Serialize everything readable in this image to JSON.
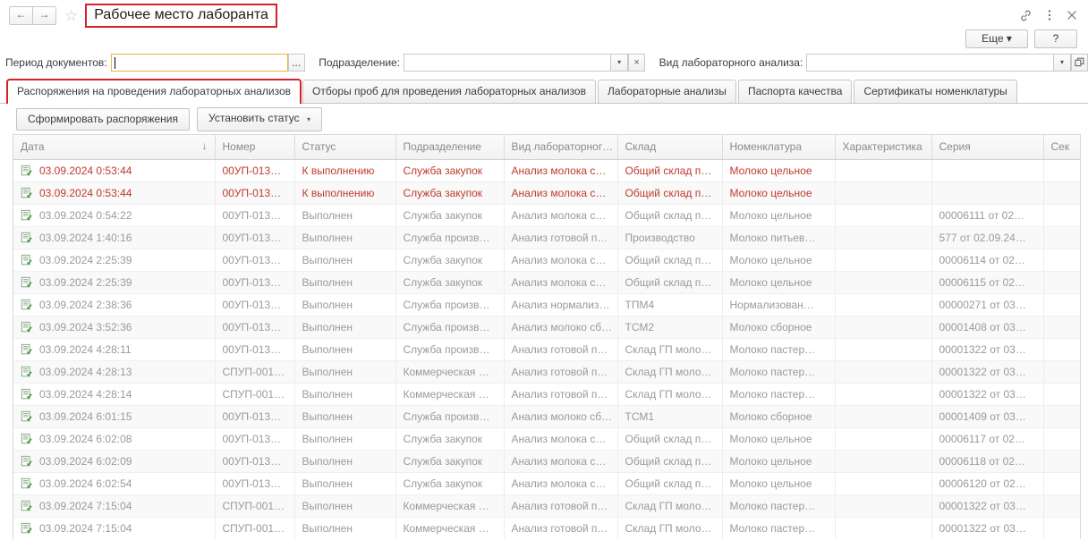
{
  "window": {
    "title": "Рабочее место лаборанта",
    "nav_back": "←",
    "nav_forward": "→",
    "favorite_icon": "star-icon",
    "link_icon": "link-icon",
    "menu_icon": "kebab-menu-icon",
    "close_icon": "close-icon"
  },
  "subbar": {
    "more_label": "Еще",
    "more_caret": "▾",
    "help_label": "?"
  },
  "filters": {
    "period_label": "Период документов:",
    "period_value": "",
    "period_select_label": "...",
    "department_label": "Подразделение:",
    "department_value": "",
    "department_dropdown": "▾",
    "department_clear": "×",
    "analysis_label": "Вид лабораторного анализа:",
    "analysis_value": "",
    "analysis_dropdown": "▾",
    "analysis_open": "open-icon"
  },
  "tabs": [
    {
      "label": "Распоряжения на проведения лабораторных анализов",
      "active": true
    },
    {
      "label": "Отборы проб для проведения лабораторных анализов",
      "active": false
    },
    {
      "label": "Лабораторные анализы",
      "active": false
    },
    {
      "label": "Паспорта качества",
      "active": false
    },
    {
      "label": "Сертификаты номенклатуры",
      "active": false
    }
  ],
  "commands": {
    "create_orders": "Сформировать распоряжения",
    "set_status": "Установить статус",
    "set_status_caret": "▾"
  },
  "table": {
    "columns": [
      {
        "label": "Дата",
        "sorted": true,
        "sort_arrow": "↓"
      },
      {
        "label": "Номер"
      },
      {
        "label": "Статус"
      },
      {
        "label": "Подразделение"
      },
      {
        "label": "Вид лабораторног…"
      },
      {
        "label": "Склад"
      },
      {
        "label": "Номенклатура"
      },
      {
        "label": "Характеристика"
      },
      {
        "label": "Серия"
      },
      {
        "label": "Сек"
      }
    ],
    "rows": [
      {
        "icon": "document-check-icon",
        "date": "03.09.2024 0:53:44",
        "number": "00УП-013…",
        "status": "К выполнению",
        "department": "Служба закупок",
        "analysis_type": "Анализ молока с…",
        "warehouse": "Общий склад п…",
        "nomenclature": "Молоко цельное",
        "characteristic": "",
        "series": "",
        "sector": "",
        "highlight": "red"
      },
      {
        "icon": "document-check-icon",
        "date": "03.09.2024 0:53:44",
        "number": "00УП-013…",
        "status": "К выполнению",
        "department": "Служба закупок",
        "analysis_type": "Анализ молока с…",
        "warehouse": "Общий склад п…",
        "nomenclature": "Молоко цельное",
        "characteristic": "",
        "series": "",
        "sector": "",
        "highlight": "red"
      },
      {
        "icon": "document-check-icon",
        "date": "03.09.2024 0:54:22",
        "number": "00УП-013…",
        "status": "Выполнен",
        "department": "Служба закупок",
        "analysis_type": "Анализ молока с…",
        "warehouse": "Общий склад п…",
        "nomenclature": "Молоко цельное",
        "characteristic": "",
        "series": "00006111 от 02…",
        "sector": "",
        "highlight": "none"
      },
      {
        "icon": "document-check-icon",
        "date": "03.09.2024 1:40:16",
        "number": "00УП-013…",
        "status": "Выполнен",
        "department": "Служба произв…",
        "analysis_type": "Анализ готовой п…",
        "warehouse": "Производство",
        "nomenclature": "Молоко питьев…",
        "characteristic": "",
        "series": "577 от 02.09.24…",
        "sector": "",
        "highlight": "none"
      },
      {
        "icon": "document-check-icon",
        "date": "03.09.2024 2:25:39",
        "number": "00УП-013…",
        "status": "Выполнен",
        "department": "Служба закупок",
        "analysis_type": "Анализ молока с…",
        "warehouse": "Общий склад п…",
        "nomenclature": "Молоко цельное",
        "characteristic": "",
        "series": "00006114 от 02…",
        "sector": "",
        "highlight": "none"
      },
      {
        "icon": "document-check-icon",
        "date": "03.09.2024 2:25:39",
        "number": "00УП-013…",
        "status": "Выполнен",
        "department": "Служба закупок",
        "analysis_type": "Анализ молока с…",
        "warehouse": "Общий склад п…",
        "nomenclature": "Молоко цельное",
        "characteristic": "",
        "series": "00006115 от 02…",
        "sector": "",
        "highlight": "none"
      },
      {
        "icon": "document-check-icon",
        "date": "03.09.2024 2:38:36",
        "number": "00УП-013…",
        "status": "Выполнен",
        "department": "Служба произв…",
        "analysis_type": "Анализ нормализ…",
        "warehouse": "ТПМ4",
        "nomenclature": "Нормализован…",
        "characteristic": "",
        "series": "00000271 от 03…",
        "sector": "",
        "highlight": "none"
      },
      {
        "icon": "document-check-icon",
        "date": "03.09.2024 3:52:36",
        "number": "00УП-013…",
        "status": "Выполнен",
        "department": "Служба произв…",
        "analysis_type": "Анализ молоко сб…",
        "warehouse": "ТСМ2",
        "nomenclature": "Молоко сборное",
        "characteristic": "",
        "series": "00001408 от 03…",
        "sector": "",
        "highlight": "none"
      },
      {
        "icon": "document-check-icon",
        "date": "03.09.2024 4:28:11",
        "number": "00УП-013…",
        "status": "Выполнен",
        "department": "Служба произв…",
        "analysis_type": "Анализ готовой п…",
        "warehouse": "Склад ГП моло…",
        "nomenclature": "Молоко пастер…",
        "characteristic": "",
        "series": "00001322 от 03…",
        "sector": "",
        "highlight": "none"
      },
      {
        "icon": "document-check-icon",
        "date": "03.09.2024 4:28:13",
        "number": "СПУП-001…",
        "status": "Выполнен",
        "department": "Коммерческая …",
        "analysis_type": "Анализ готовой п…",
        "warehouse": "Склад ГП моло…",
        "nomenclature": "Молоко пастер…",
        "characteristic": "",
        "series": "00001322 от 03…",
        "sector": "",
        "highlight": "none"
      },
      {
        "icon": "document-check-icon",
        "date": "03.09.2024 4:28:14",
        "number": "СПУП-001…",
        "status": "Выполнен",
        "department": "Коммерческая …",
        "analysis_type": "Анализ готовой п…",
        "warehouse": "Склад ГП моло…",
        "nomenclature": "Молоко пастер…",
        "characteristic": "",
        "series": "00001322 от 03…",
        "sector": "",
        "highlight": "none"
      },
      {
        "icon": "document-check-icon",
        "date": "03.09.2024 6:01:15",
        "number": "00УП-013…",
        "status": "Выполнен",
        "department": "Служба произв…",
        "analysis_type": "Анализ молоко сб…",
        "warehouse": "ТСМ1",
        "nomenclature": "Молоко сборное",
        "characteristic": "",
        "series": "00001409 от 03…",
        "sector": "",
        "highlight": "none"
      },
      {
        "icon": "document-check-icon",
        "date": "03.09.2024 6:02:08",
        "number": "00УП-013…",
        "status": "Выполнен",
        "department": "Служба закупок",
        "analysis_type": "Анализ молока с…",
        "warehouse": "Общий склад п…",
        "nomenclature": "Молоко цельное",
        "characteristic": "",
        "series": "00006117 от 02…",
        "sector": "",
        "highlight": "none"
      },
      {
        "icon": "document-check-icon",
        "date": "03.09.2024 6:02:09",
        "number": "00УП-013…",
        "status": "Выполнен",
        "department": "Служба закупок",
        "analysis_type": "Анализ молока с…",
        "warehouse": "Общий склад п…",
        "nomenclature": "Молоко цельное",
        "characteristic": "",
        "series": "00006118 от 02…",
        "sector": "",
        "highlight": "none"
      },
      {
        "icon": "document-check-icon",
        "date": "03.09.2024 6:02:54",
        "number": "00УП-013…",
        "status": "Выполнен",
        "department": "Служба закупок",
        "analysis_type": "Анализ молока с…",
        "warehouse": "Общий склад п…",
        "nomenclature": "Молоко цельное",
        "characteristic": "",
        "series": "00006120 от 02…",
        "sector": "",
        "highlight": "none"
      },
      {
        "icon": "document-check-icon",
        "date": "03.09.2024 7:15:04",
        "number": "СПУП-001…",
        "status": "Выполнен",
        "department": "Коммерческая …",
        "analysis_type": "Анализ готовой п…",
        "warehouse": "Склад ГП моло…",
        "nomenclature": "Молоко пастер…",
        "characteristic": "",
        "series": "00001322 от 03…",
        "sector": "",
        "highlight": "none"
      },
      {
        "icon": "document-check-icon",
        "date": "03.09.2024 7:15:04",
        "number": "СПУП-001…",
        "status": "Выполнен",
        "department": "Коммерческая …",
        "analysis_type": "Анализ готовой п…",
        "warehouse": "Склад ГП моло…",
        "nomenclature": "Молоко пастер…",
        "characteristic": "",
        "series": "00001322 от 03…",
        "sector": "",
        "highlight": "none"
      }
    ]
  },
  "colors": {
    "accent_red": "#d3222a",
    "row_red": "#c0392b",
    "focus_yellow": "#e5b83c",
    "text_gray": "#9a9a9a"
  }
}
